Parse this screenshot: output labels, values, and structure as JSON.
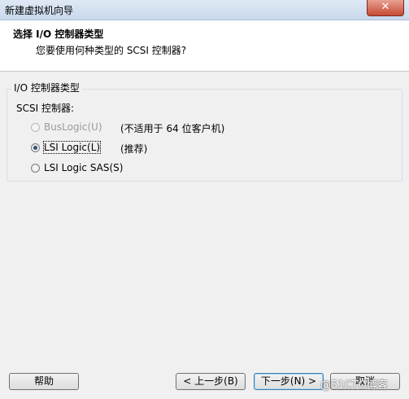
{
  "window": {
    "title": "新建虚拟机向导",
    "close_glyph": "✕"
  },
  "header": {
    "title": "选择 I/O 控制器类型",
    "subtitle": "您要使用何种类型的 SCSI 控制器?"
  },
  "group": {
    "label": "I/O 控制器类型",
    "scsi_label": "SCSI 控制器:",
    "options": [
      {
        "label": "BusLogic(U)",
        "note": "(不适用于 64 位客户机)",
        "selected": false,
        "disabled": true
      },
      {
        "label": "LSI Logic(L)",
        "note": "(推荐)",
        "selected": true,
        "disabled": false
      },
      {
        "label": "LSI Logic SAS(S)",
        "note": "",
        "selected": false,
        "disabled": false
      }
    ]
  },
  "buttons": {
    "help": "帮助",
    "back": "< 上一步(B)",
    "next": "下一步(N) >",
    "cancel": "取消"
  },
  "watermark": "@51CTO博客"
}
